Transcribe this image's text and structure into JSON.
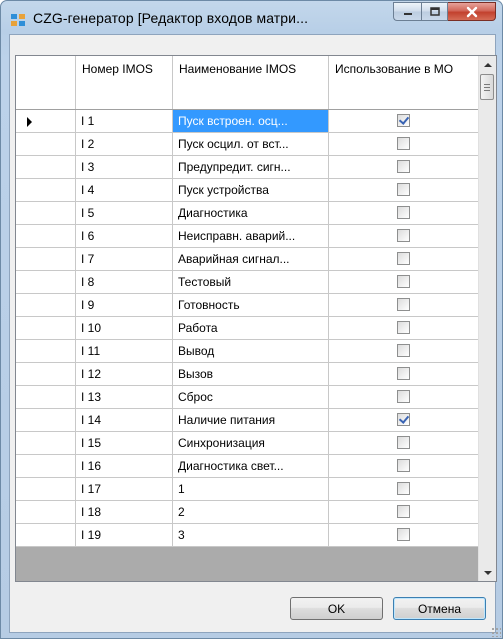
{
  "window": {
    "title": "CZG-генератор [Редактор входов матри...",
    "buttons": {
      "minimize": "minimize-icon",
      "maximize": "maximize-icon",
      "close": "close-icon"
    }
  },
  "grid": {
    "columns": [
      "",
      "Номер IMOS",
      "Наименование IMOS",
      "Использование в МО"
    ],
    "current_row": 0,
    "rows": [
      {
        "num": "I 1",
        "name": "Пуск встроен. осц...",
        "used": true
      },
      {
        "num": "I 2",
        "name": "Пуск осцил. от вст...",
        "used": false
      },
      {
        "num": "I 3",
        "name": "Предупредит. сигн...",
        "used": false
      },
      {
        "num": "I 4",
        "name": "Пуск устройства",
        "used": false
      },
      {
        "num": "I 5",
        "name": "Диагностика",
        "used": false
      },
      {
        "num": "I 6",
        "name": "Неисправн. аварий...",
        "used": false
      },
      {
        "num": "I 7",
        "name": "Аварийная сигнал...",
        "used": false
      },
      {
        "num": "I 8",
        "name": "Тестовый",
        "used": false
      },
      {
        "num": "I 9",
        "name": "Готовность",
        "used": false
      },
      {
        "num": "I 10",
        "name": "Работа",
        "used": false
      },
      {
        "num": "I 11",
        "name": "Вывод",
        "used": false
      },
      {
        "num": "I 12",
        "name": "Вызов",
        "used": false
      },
      {
        "num": "I 13",
        "name": "Сброс",
        "used": false
      },
      {
        "num": "I 14",
        "name": "Наличие питания",
        "used": true
      },
      {
        "num": "I 15",
        "name": "Синхронизация",
        "used": false
      },
      {
        "num": "I 16",
        "name": "Диагностика свет...",
        "used": false
      },
      {
        "num": "I 17",
        "name": "1",
        "used": false
      },
      {
        "num": "I 18",
        "name": "2",
        "used": false
      },
      {
        "num": "I 19",
        "name": "3",
        "used": false
      }
    ]
  },
  "buttons": {
    "ok": "OK",
    "cancel": "Отмена"
  },
  "colors": {
    "selection": "#3399ff",
    "titlebar": "#b9d1ea",
    "close": "#c7483a"
  }
}
